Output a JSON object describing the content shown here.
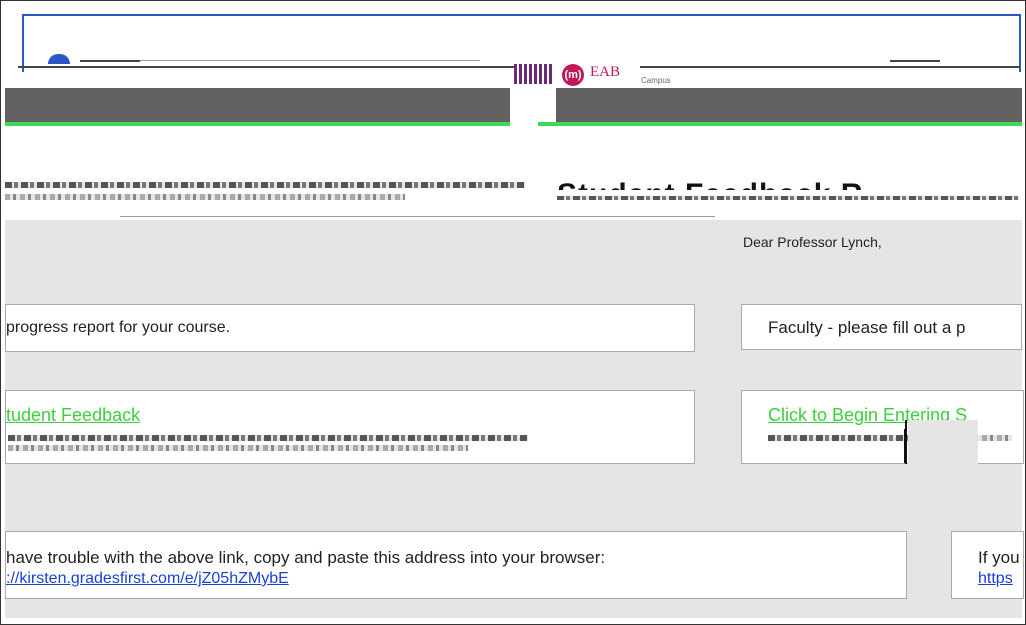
{
  "header": {
    "logo_badge": "(m)",
    "logo_text": "EAB",
    "campus_label": "Campus"
  },
  "greeting": "Dear Professor Lynch,",
  "prompt_left": "progress report for your course.",
  "prompt_right": "Faculty - please fill out a p",
  "action_left": "tudent Feedback",
  "action_right": "Click to Begin Entering S",
  "trouble_text": "have trouble with the above link, copy and paste this address into your browser:",
  "trouble_url": "://kirsten.gradesfirst.com/e/jZ05hZMybE",
  "trouble_right": "If you",
  "trouble_url_right": "https",
  "colors": {
    "green_link": "#3ad13a",
    "blue_link": "#1a3fd6",
    "dark_bar": "#616161",
    "accent_green": "#3fd95a"
  }
}
